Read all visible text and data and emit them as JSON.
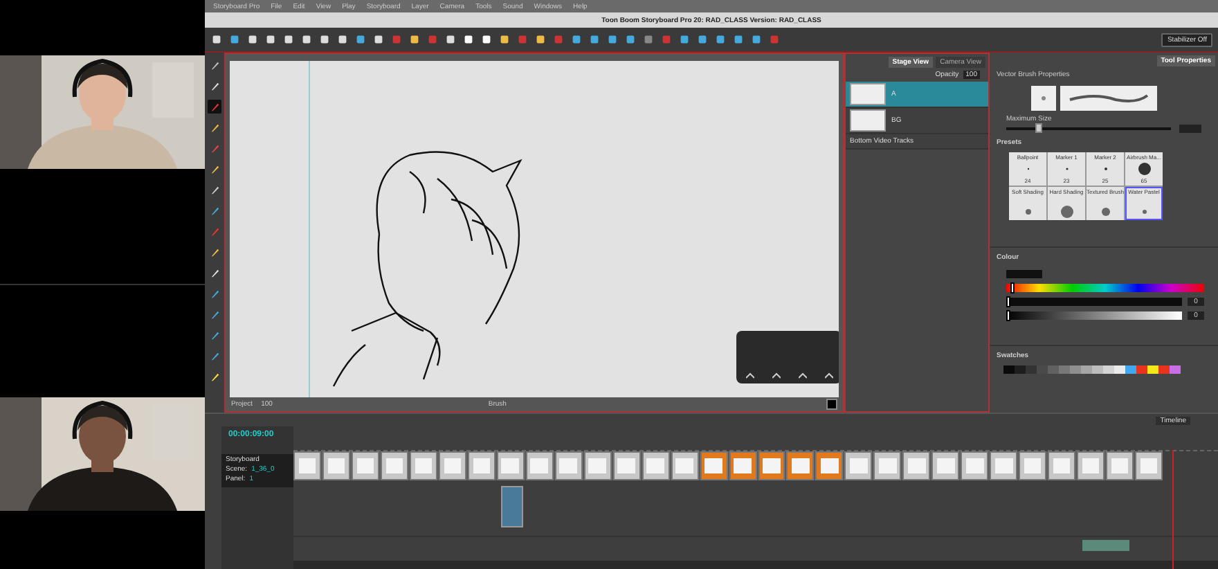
{
  "menu_bar": {
    "items": [
      "Storyboard Pro",
      "File",
      "Edit",
      "View",
      "Play",
      "Storyboard",
      "Layer",
      "Camera",
      "Tools",
      "Sound",
      "Windows",
      "Help"
    ]
  },
  "window": {
    "title": "Toon Boom Storyboard Pro 20: RAD_CLASS Version: RAD_CLASS"
  },
  "toolbar": {
    "stabilizer": "Stabilizer Off"
  },
  "tools": [
    {
      "selected": false
    },
    {
      "selected": false
    },
    {
      "selected": true
    },
    {
      "selected": false
    },
    {
      "selected": false
    },
    {
      "selected": false
    },
    {
      "selected": false
    },
    {
      "selected": false
    },
    {
      "selected": false
    },
    {
      "selected": false
    },
    {
      "selected": false
    },
    {
      "selected": false
    },
    {
      "selected": false
    },
    {
      "selected": false
    },
    {
      "selected": false
    },
    {
      "selected": false
    }
  ],
  "stage_view": {
    "bottom_bar": {
      "zoom_label": "Project",
      "zoom": "100",
      "brush_label": "Brush"
    }
  },
  "layers": {
    "tabs": [
      {
        "label": "Stage View",
        "selected": true
      },
      {
        "label": "Camera View",
        "selected": false
      }
    ],
    "opacity_label": "Opacity",
    "opacity": "100",
    "rows": [
      {
        "name": "A",
        "selected": true
      },
      {
        "name": "BG",
        "selected": false
      },
      {
        "name": "Bottom Video Tracks",
        "selected": false
      }
    ]
  },
  "tool_properties": {
    "tabs": [
      {
        "label": "Tool Properties",
        "selected": true
      }
    ],
    "title": "Vector Brush Properties",
    "size_slider": {
      "label": "Maximum Size",
      "level": 0.18
    },
    "presets_label": "Presets",
    "presets": [
      {
        "name": "Ballpoint",
        "size": "24",
        "selected": false
      },
      {
        "name": "Marker 1",
        "size": "23",
        "selected": false
      },
      {
        "name": "Marker 2",
        "size": "25",
        "selected": false
      },
      {
        "name": "Airbrush Ma...",
        "size": "65",
        "selected": false
      },
      {
        "name": "Soft Shading",
        "selected": false
      },
      {
        "name": "Hard Shading",
        "selected": false
      },
      {
        "name": "Textured Brush",
        "selected": false
      },
      {
        "name": "Water Pastel",
        "selected": true
      }
    ]
  },
  "colour": {
    "label": "Colour",
    "hue": {
      "level": 0.02
    },
    "sliders": [
      {
        "level": 0,
        "value": "0"
      },
      {
        "level": 0,
        "value": "0"
      }
    ]
  },
  "swatches": {
    "label": "Swatches",
    "colors": [
      {
        "color": "#0a0a0a"
      },
      {
        "color": "#1e1e1e"
      },
      {
        "color": "#333333"
      },
      {
        "color": "#4a4a4a"
      },
      {
        "color": "#616161"
      },
      {
        "color": "#787878"
      },
      {
        "color": "#8f8f8f"
      },
      {
        "color": "#a6a6a6"
      },
      {
        "color": "#bdbdbd"
      },
      {
        "color": "#d4d4d4"
      },
      {
        "color": "#ebebeb"
      },
      {
        "color": "#41a8f0"
      },
      {
        "color": "#e8341c"
      },
      {
        "color": "#f2e81a"
      },
      {
        "color": "#e8341c"
      },
      {
        "color": "#c86ee6"
      }
    ]
  },
  "timeline": {
    "title": "Timeline",
    "timecode": "00:00:09:00",
    "storyboard_label": "Storyboard",
    "scene_label": "Scene:",
    "scene": "1_36_0",
    "panel_label": "Panel:",
    "panel": "1",
    "panels": [
      {
        "selected": false
      },
      {
        "selected": false
      },
      {
        "selected": false
      },
      {
        "selected": false
      },
      {
        "selected": false
      },
      {
        "selected": false
      },
      {
        "selected": false
      },
      {
        "selected": false
      },
      {
        "selected": false
      },
      {
        "selected": false
      },
      {
        "selected": false
      },
      {
        "selected": false
      },
      {
        "selected": false
      },
      {
        "selected": false
      },
      {
        "selected": true
      },
      {
        "selected": true
      },
      {
        "selected": true
      },
      {
        "selected": true
      },
      {
        "selected": true
      },
      {
        "selected": false
      },
      {
        "selected": false
      },
      {
        "selected": false
      },
      {
        "selected": false
      },
      {
        "selected": false
      },
      {
        "selected": false
      },
      {
        "selected": false
      },
      {
        "selected": false
      },
      {
        "selected": false
      },
      {
        "selected": false
      },
      {
        "selected": false
      }
    ]
  }
}
